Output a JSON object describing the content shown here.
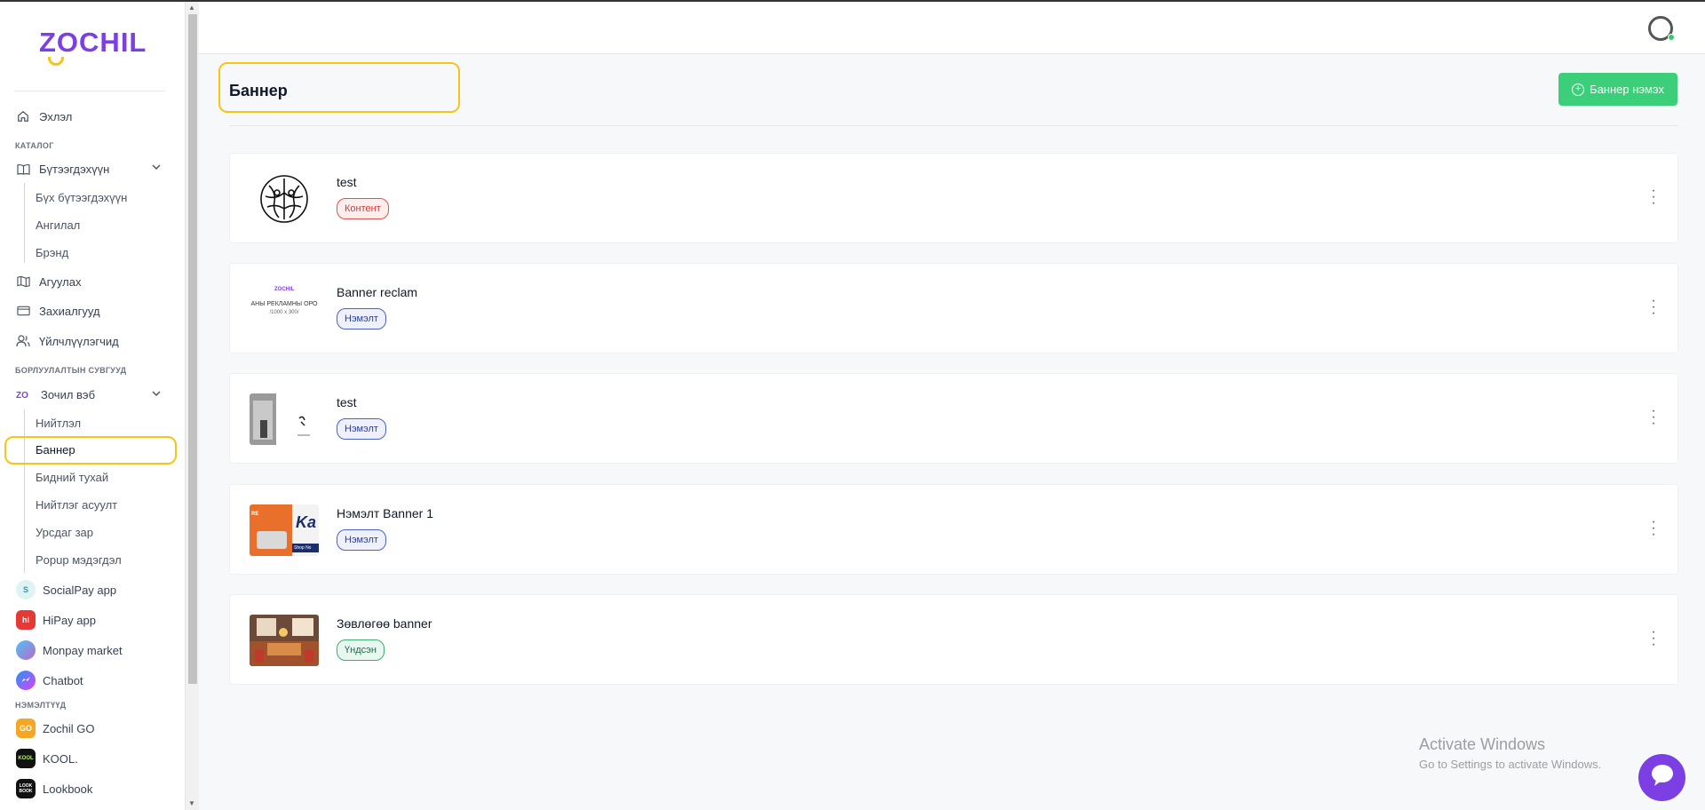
{
  "brand": {
    "logo_text": "ZOCHIL",
    "accent": "#7b3fe4",
    "highlight": "#f5c518"
  },
  "sidebar": {
    "home": "Эхлэл",
    "section_catalog": "КАТАЛОГ",
    "products": "Бүтээгдэхүүн",
    "products_sub": [
      "Бүх бүтээгдэхүүн",
      "Ангилал",
      "Брэнд"
    ],
    "warehouse": "Агуулах",
    "orders": "Захиалгууд",
    "customers": "Үйлчлүүлэгчид",
    "section_channels": "БОРЛУУЛАЛТЫН СУВГУУД",
    "zochil_web": "Зочил вэб",
    "web_sub": [
      "Нийтлэл",
      "Баннер",
      "Бидний тухай",
      "Нийтлэг асуулт",
      "Урсдаг зар",
      "Popup мэдэгдэл"
    ],
    "apps": [
      "SocialPay app",
      "HiPay app",
      "Monpay market",
      "Chatbot"
    ],
    "section_addons": "НЭМЭЛТҮҮД",
    "addons": [
      "Zochil GO",
      "KOOL.",
      "Lookbook"
    ]
  },
  "main": {
    "title": "Баннер",
    "add_button": "Баннер нэмэх",
    "banners": [
      {
        "title": "test",
        "badge": "Контент",
        "badge_color": "red"
      },
      {
        "title": "Banner reclam",
        "badge": "Нэмэлт",
        "badge_color": "blue"
      },
      {
        "title": "test",
        "badge": "Нэмэлт",
        "badge_color": "blue"
      },
      {
        "title": "Нэмэлт Banner 1",
        "badge": "Нэмэлт",
        "badge_color": "blue"
      },
      {
        "title": "Зөвлөгөө banner",
        "badge": "Үндсэн",
        "badge_color": "green"
      }
    ]
  },
  "thumbs": {
    "banner2_line1": "ZOCHIL",
    "banner2_line2": "АНЫ РЕКЛАМНЫ ОРО",
    "banner2_line3": "/1000 x 300/",
    "banner4_text": "Ka",
    "banner4_side": "RE",
    "banner4_shop": "Shop No"
  },
  "watermark": {
    "line1": "Activate Windows",
    "line2": "Go to Settings to activate Windows."
  }
}
